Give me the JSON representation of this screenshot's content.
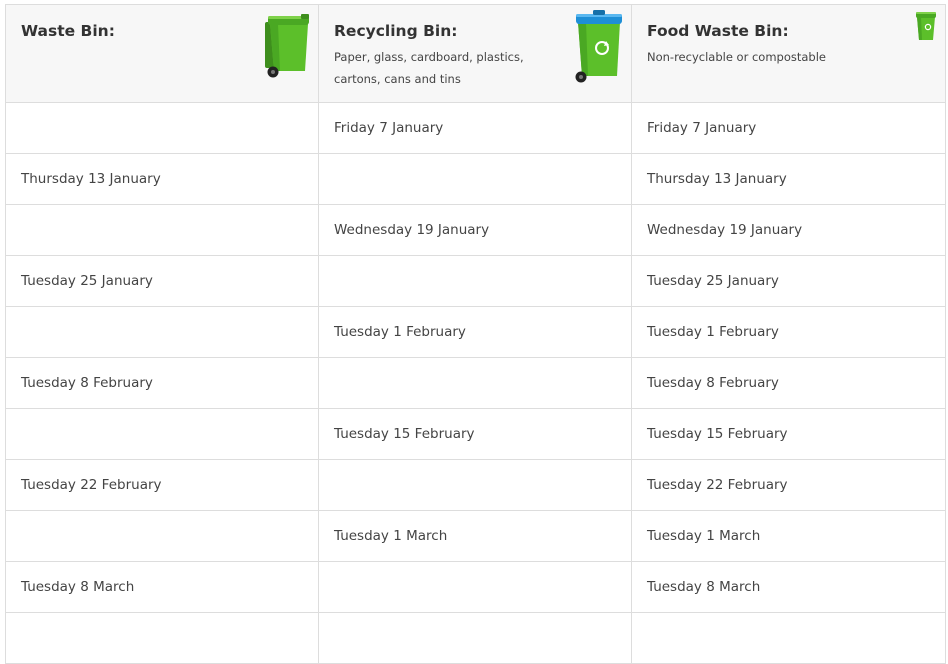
{
  "colors": {
    "bin_green": "#5cbf2a",
    "bin_green_dark": "#3e8e1d",
    "recycle_lid_blue": "#1e8fd6",
    "header_bg": "#f7f7f7",
    "border": "#dddddd"
  },
  "headers": [
    {
      "title": "Waste Bin:",
      "subtitle": "",
      "icon": "waste-bin-icon"
    },
    {
      "title": "Recycling Bin:",
      "subtitle": "Paper, glass, cardboard, plastics, cartons, cans and tins",
      "icon": "recycling-bin-icon"
    },
    {
      "title": "Food Waste Bin:",
      "subtitle": "Non-recyclable or compostable",
      "icon": "food-waste-bin-icon"
    }
  ],
  "rows": [
    [
      "",
      "Friday 7 January",
      "Friday 7 January"
    ],
    [
      "Thursday 13 January",
      "",
      "Thursday 13 January"
    ],
    [
      "",
      "Wednesday 19 January",
      "Wednesday 19 January"
    ],
    [
      "Tuesday 25 January",
      "",
      "Tuesday 25 January"
    ],
    [
      "",
      "Tuesday 1 February",
      "Tuesday 1 February"
    ],
    [
      "Tuesday 8 February",
      "",
      "Tuesday 8 February"
    ],
    [
      "",
      "Tuesday 15 February",
      "Tuesday 15 February"
    ],
    [
      "Tuesday 22 February",
      "",
      "Tuesday 22 February"
    ],
    [
      "",
      "Tuesday 1 March",
      "Tuesday 1 March"
    ],
    [
      "Tuesday 8 March",
      "",
      "Tuesday 8 March"
    ],
    [
      "",
      "",
      ""
    ]
  ]
}
